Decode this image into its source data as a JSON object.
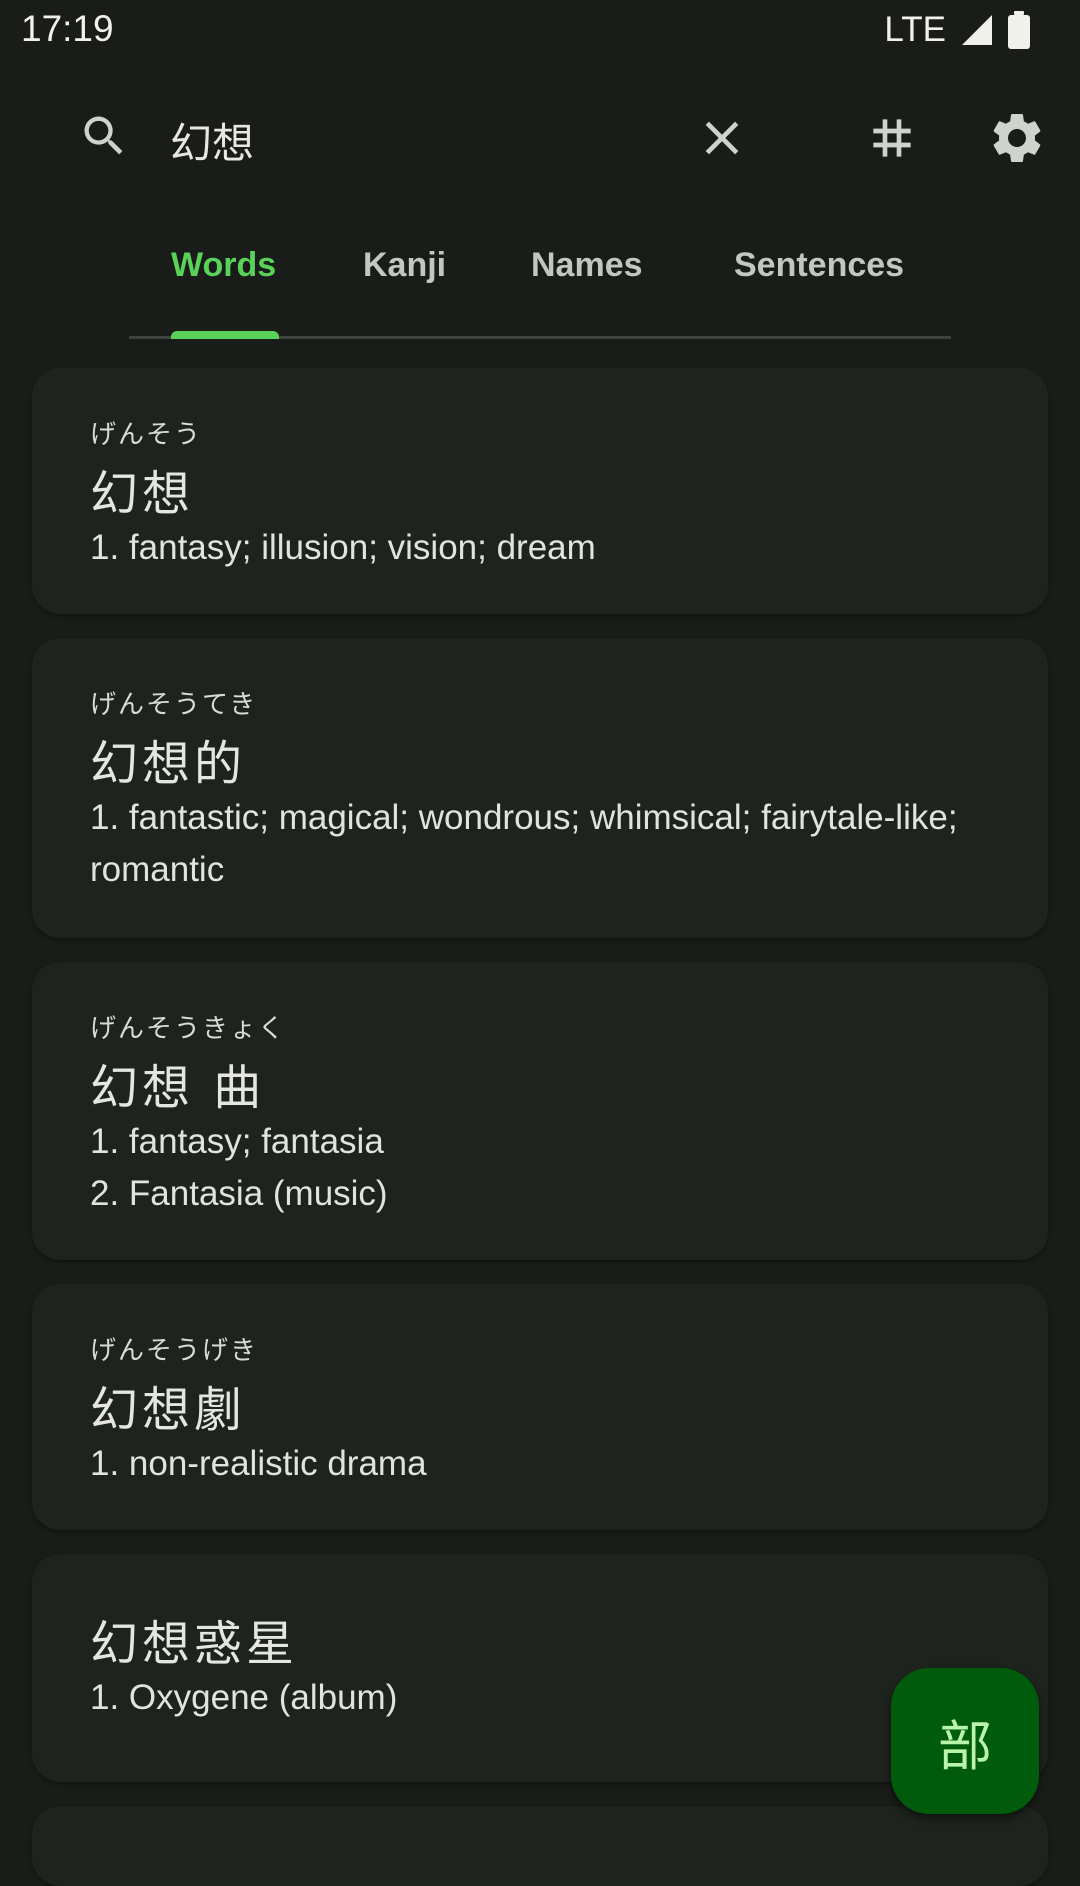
{
  "status_bar": {
    "time": "17:19",
    "network": "LTE"
  },
  "search": {
    "query": "幻想"
  },
  "tabs": [
    {
      "label": "Words",
      "active": true
    },
    {
      "label": "Kanji",
      "active": false
    },
    {
      "label": "Names",
      "active": false
    },
    {
      "label": "Sentences",
      "active": false
    }
  ],
  "results": [
    {
      "reading": "げんそう",
      "word": "幻想",
      "glosses": [
        "1. fantasy; illusion; vision; dream"
      ]
    },
    {
      "reading": "げんそうてき",
      "word": "幻想的",
      "glosses": [
        "1. fantastic; magical; wondrous; whimsical; fairytale-like; romantic"
      ]
    },
    {
      "reading": "げんそうきょく",
      "word": "幻想 曲",
      "glosses": [
        "1. fantasy; fantasia",
        "2. Fantasia (music)"
      ]
    },
    {
      "reading": "げんそうげき",
      "word": "幻想劇",
      "glosses": [
        "1. non-realistic drama"
      ]
    },
    {
      "reading": "",
      "word": "幻想惑星",
      "glosses": [
        "1. Oxygene (album)"
      ]
    }
  ],
  "fab": {
    "label": "部"
  },
  "colors": {
    "background": "#1a1c19",
    "card": "#1e231e",
    "accent": "#59d25a",
    "fab": "#005b0d"
  }
}
